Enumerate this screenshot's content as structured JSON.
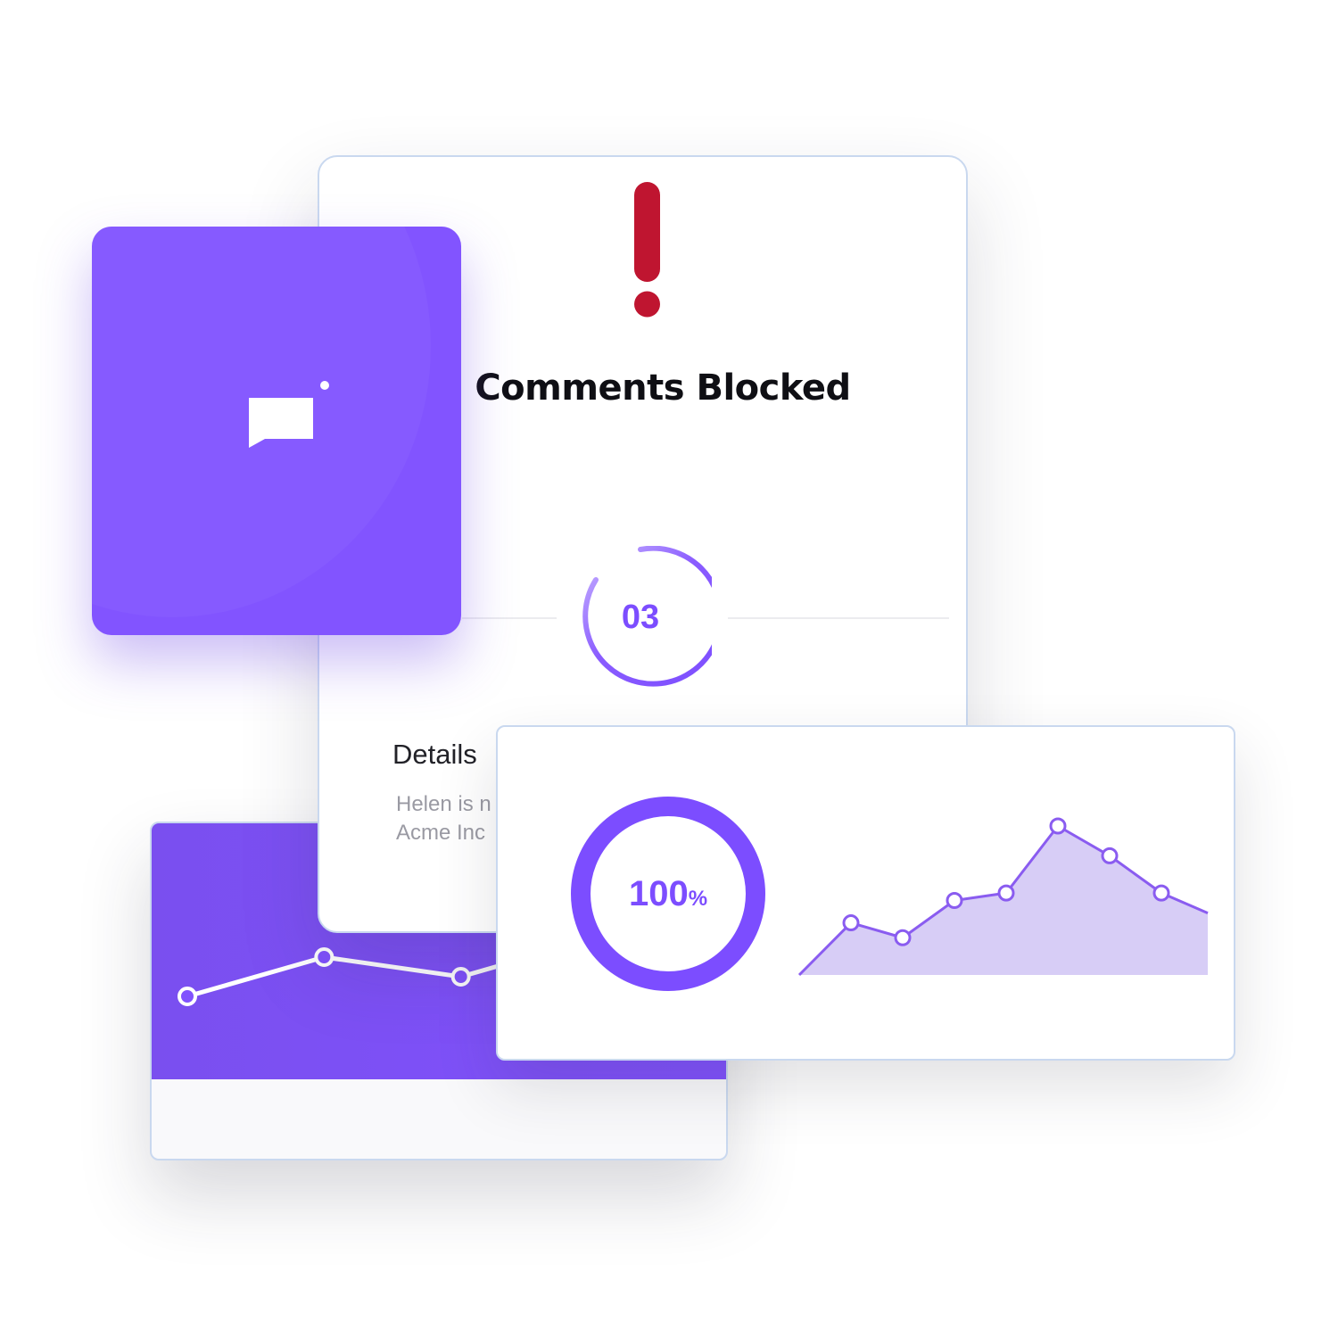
{
  "notification": {
    "title": "Comments Blocked",
    "count": "03",
    "details_heading": "Details",
    "details_lines": [
      "Helen is n",
      "Acme Inc"
    ]
  },
  "stats": {
    "percent_value": "100",
    "percent_unit": "%",
    "progress": 1.0
  },
  "icons": {
    "alert": "exclamation-icon",
    "app": "chat-bubble-icon"
  },
  "colors": {
    "accent": "#8152fe",
    "alert": "#bf1530",
    "area_fill": "#d7cdf6",
    "card_border": "#c9d8ef"
  },
  "chart_data": [
    {
      "type": "line",
      "x": [
        1,
        2,
        3,
        4
      ],
      "values": [
        30,
        50,
        40,
        60
      ],
      "ylim": [
        0,
        100
      ]
    },
    {
      "type": "area",
      "x": [
        0,
        1,
        2,
        3,
        4,
        5,
        6,
        7,
        8
      ],
      "values": [
        0,
        35,
        25,
        50,
        55,
        100,
        80,
        55,
        40
      ],
      "ylim": [
        0,
        100
      ]
    }
  ]
}
